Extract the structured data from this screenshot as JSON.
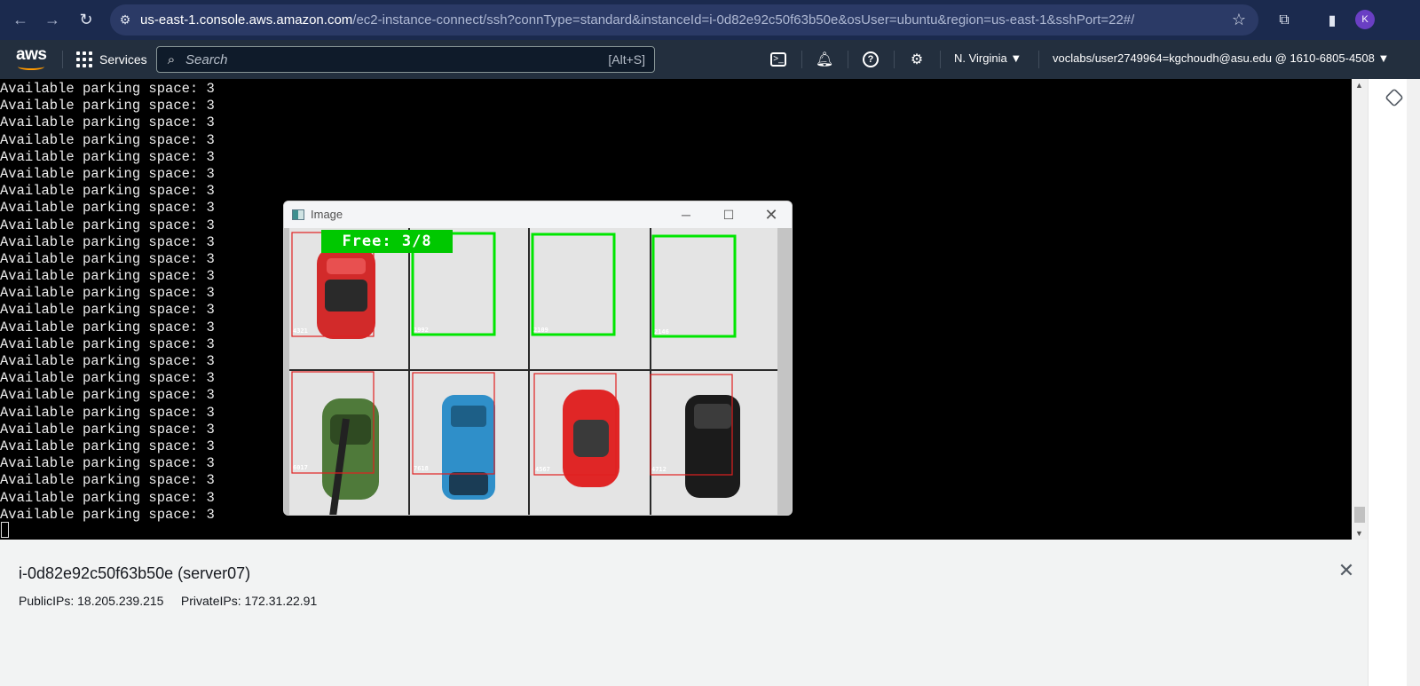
{
  "browser": {
    "url_host": "us-east-1.console.aws.amazon.com",
    "url_rest": "/ec2-instance-connect/ssh?connType=standard&instanceId=i-0d82e92c50f63b50e&osUser=ubuntu&region=us-east-1&sshPort=22#/",
    "profile_initial": "K"
  },
  "aws_header": {
    "logo": "aws",
    "services_label": "Services",
    "search_placeholder": "Search",
    "search_shortcut": "[Alt+S]",
    "region": "N. Virginia ▼",
    "account": "voclabs/user2749964=kgchoudh@asu.edu @ 1610-6805-4508 ▼"
  },
  "terminal": {
    "lines": [
      "Available parking space: 3",
      "Available parking space: 3",
      "Available parking space: 3",
      "Available parking space: 3",
      "Available parking space: 3",
      "Available parking space: 3",
      "Available parking space: 3",
      "Available parking space: 3",
      "Available parking space: 3",
      "Available parking space: 3",
      "Available parking space: 3",
      "Available parking space: 3",
      "Available parking space: 3",
      "Available parking space: 3",
      "Available parking space: 3",
      "Available parking space: 3",
      "Available parking space: 3",
      "Available parking space: 3",
      "Available parking space: 3",
      "Available parking space: 3",
      "Available parking space: 3",
      "Available parking space: 3",
      "Available parking space: 3",
      "Available parking space: 3",
      "Available parking space: 3",
      "Available parking space: 3"
    ]
  },
  "image_window": {
    "title": "Image",
    "free_label": "Free: 3/8",
    "slot_counts": [
      "4321",
      "1992",
      "2109",
      "2146",
      "6017",
      "7618",
      "4567",
      "4712"
    ],
    "colors": {
      "free": "#00e600",
      "occupied": "#e02020"
    }
  },
  "instance": {
    "title": "i-0d82e92c50f63b50e (server07)",
    "ips": "PublicIPs: 18.205.239.215     PrivateIPs: 172.31.22.91"
  }
}
